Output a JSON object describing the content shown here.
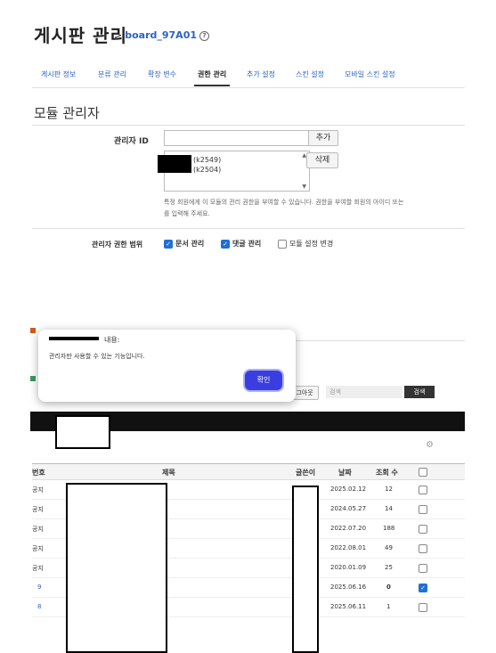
{
  "header": {
    "title": "게시판 관리",
    "board_id": "board_97A01"
  },
  "tabs": [
    {
      "label": "게시판 정보"
    },
    {
      "label": "분류 관리"
    },
    {
      "label": "확장 변수"
    },
    {
      "label": "권한 관리"
    },
    {
      "label": "추가 설정"
    },
    {
      "label": "스킨 설정"
    },
    {
      "label": "모바일 스킨 설정"
    }
  ],
  "section_title": "모듈 관리자",
  "admin": {
    "label": "관리자 ID",
    "input_value": "",
    "add_label": "추가",
    "delete_label": "삭제",
    "list": [
      "(k2549)",
      "(k2504)"
    ],
    "note_line1": "특정 회원에게 이 모듈의 관리 권한을 부여할 수 있습니다. 권한을 부여할 회원의 아이디 또는",
    "note_line2": "를 입력해 주세요."
  },
  "perm": {
    "label": "관리자 권한 범위",
    "doc": "문서 관리",
    "comment": "댓글 관리",
    "module": "모듈 설정 변경"
  },
  "dialog": {
    "title": "내용:",
    "message": "관리자만 사용할 수 있는 기능입니다.",
    "ok": "확인"
  },
  "background": {
    "logout_label": "그아웃",
    "search_placeholder": "검색",
    "search_button": "검색"
  },
  "table": {
    "headers": {
      "no": "번호",
      "title": "제목",
      "author": "글쓴이",
      "date": "날짜",
      "views": "조회 수"
    },
    "rows": [
      {
        "no": "공지",
        "date": "2025.02.12",
        "views": "12",
        "checked": false
      },
      {
        "no": "공지",
        "date": "2024.05.27",
        "views": "14",
        "checked": false
      },
      {
        "no": "공지",
        "date": "2022.07.20",
        "views": "188",
        "checked": false
      },
      {
        "no": "공지",
        "date": "2022.08.01",
        "views": "49",
        "checked": false
      },
      {
        "no": "공지",
        "date": "2020.01.09",
        "views": "25",
        "checked": false
      },
      {
        "no": "9",
        "date": "2025.06.16",
        "views": "0",
        "checked": true
      },
      {
        "no": "8",
        "date": "2025.06.11",
        "views": "1",
        "checked": false
      }
    ]
  },
  "colors": {
    "accent": "#2b62c8",
    "ok_button": "#3a3ee0",
    "check": "#1f6fd6"
  }
}
